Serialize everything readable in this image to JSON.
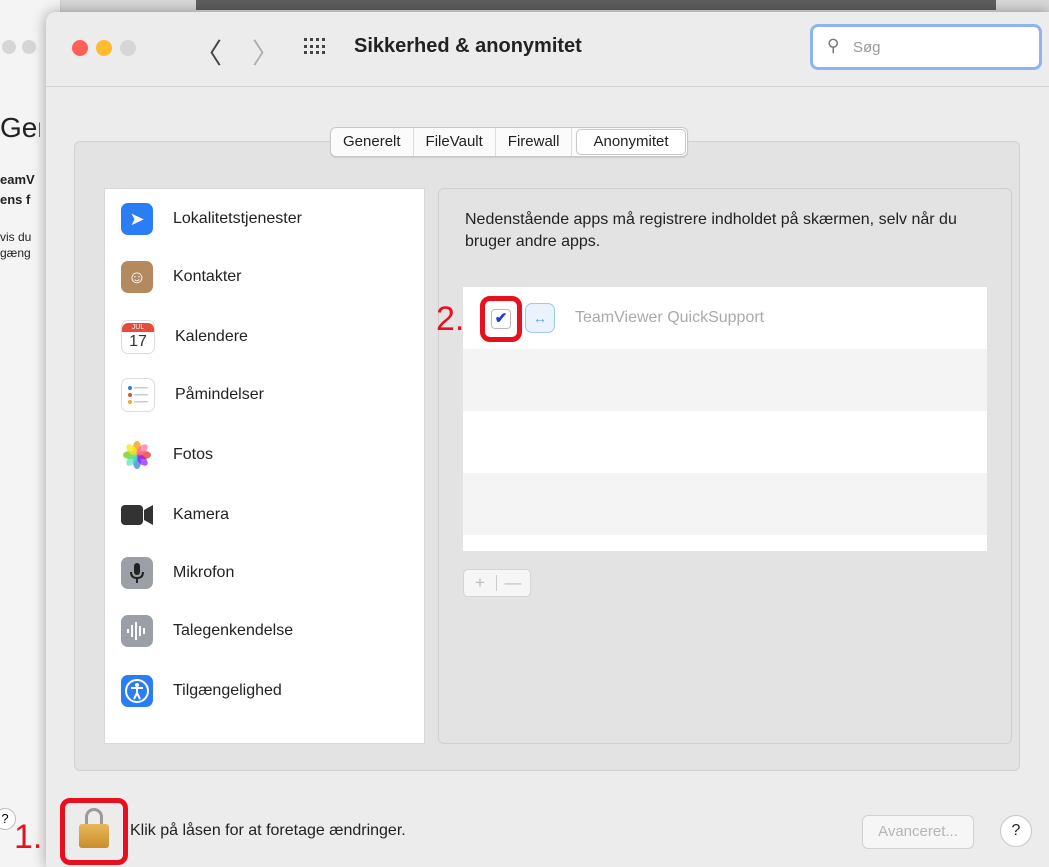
{
  "background_window": {
    "text_1": "Gen",
    "text_2": "eamV",
    "text_3": "ens f",
    "text_4": "vis du",
    "text_5": "gæng",
    "help": "?"
  },
  "window": {
    "title": "Sikkerhed & anonymitet",
    "nav_back": "〈",
    "nav_forward": "〉",
    "search": {
      "placeholder": "Søg",
      "value": ""
    }
  },
  "tabs": [
    {
      "label": "Generelt",
      "active": false
    },
    {
      "label": "FileVault",
      "active": false
    },
    {
      "label": "Firewall",
      "active": false
    },
    {
      "label": "Anonymitet",
      "active": true
    }
  ],
  "sidebar": {
    "items": [
      {
        "label": "Lokalitetstjenester",
        "icon": "location-icon"
      },
      {
        "label": "Kontakter",
        "icon": "contacts-icon"
      },
      {
        "label": "Kalendere",
        "icon": "calendar-icon",
        "month": "JUL",
        "day": "17"
      },
      {
        "label": "Påmindelser",
        "icon": "reminders-icon"
      },
      {
        "label": "Fotos",
        "icon": "photos-icon"
      },
      {
        "label": "Kamera",
        "icon": "camera-icon"
      },
      {
        "label": "Mikrofon",
        "icon": "microphone-icon"
      },
      {
        "label": "Talegenkendelse",
        "icon": "speech-recognition-icon"
      },
      {
        "label": "Tilgængelighed",
        "icon": "accessibility-icon"
      }
    ]
  },
  "detail": {
    "description": "Nedenstående apps må registrere indholdet på skærmen, selv når du bruger andre apps.",
    "apps": [
      {
        "name": "TeamViewer QuickSupport",
        "checked": true
      }
    ],
    "add_label": "+",
    "remove_label": "—"
  },
  "footer": {
    "lock_text": "Klik på låsen for at foretage ændringer.",
    "advanced_label": "Avanceret...",
    "help_label": "?"
  },
  "annotations": {
    "step_1": "1.",
    "step_2": "2."
  },
  "colors": {
    "accent": "#2a7df5",
    "annotation": "#e8101f",
    "checkmark": "#1f3ad6"
  }
}
